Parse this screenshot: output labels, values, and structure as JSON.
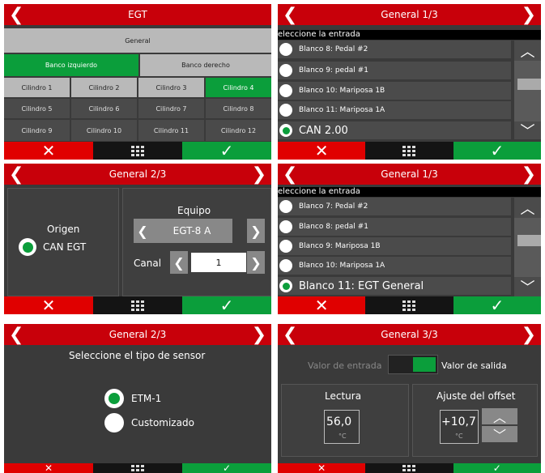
{
  "p1": {
    "title": "EGT",
    "general": "General",
    "left_bank": "Banco izquierdo",
    "right_bank": "Banco derecho",
    "cyl": [
      "Cilindro 1",
      "Cilindro 2",
      "Cilindro 3",
      "Cilindro 4",
      "Cilindro 5",
      "Cilindro 6",
      "Cilindro 7",
      "Cilindro 8",
      "Cilindro 9",
      "Cilindro 10",
      "Cilindro 11",
      "Cilindro 12"
    ]
  },
  "p2": {
    "title": "General 1/3",
    "subtitle": "eleccione la entrada",
    "items": [
      "Blanco 8: Pedal #2",
      "Blanco 9: pedal #1",
      "Blanco 10: Mariposa 1B",
      "Blanco 11: Mariposa 1A",
      "CAN 2.00"
    ]
  },
  "p3": {
    "title": "General 2/3",
    "origin_label": "Origen",
    "origin_value": "CAN EGT",
    "equipo_label": "Equipo",
    "equipo_value": "EGT-8 A",
    "canal_label": "Canal",
    "canal_value": "1"
  },
  "p4": {
    "title": "General 1/3",
    "subtitle": "eleccione la entrada",
    "items": [
      "Blanco 7: Pedal #2",
      "Blanco 8: pedal #1",
      "Blanco 9: Mariposa 1B",
      "Blanco 10: Mariposa 1A",
      "Blanco 11: EGT General"
    ]
  },
  "p5": {
    "title": "General 2/3",
    "prompt": "Seleccione el tipo de sensor",
    "opt1": "ETM-1",
    "opt2": "Customizado"
  },
  "p6": {
    "title": "General 3/3",
    "input_label": "Valor de entrada",
    "output_label": "Valor de salida",
    "lectura_label": "Lectura",
    "lectura_value": "56,0",
    "lectura_unit": "°C",
    "offset_label": "Ajuste del offset",
    "offset_value": "+10,7",
    "offset_unit": "°C"
  },
  "common": {
    "cancel": "✕",
    "ok": "✓",
    "left_arrow": "❮",
    "right_arrow": "❯",
    "up": "︿",
    "down": "﹀"
  }
}
